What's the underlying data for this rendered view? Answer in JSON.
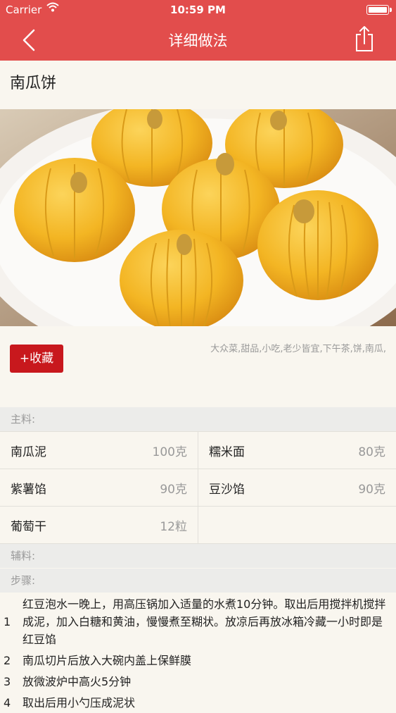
{
  "status_bar": {
    "carrier": "Carrier",
    "time": "10:59 PM"
  },
  "nav": {
    "title": "详细做法",
    "back_icon": "chevron-left-icon",
    "share_icon": "share-icon"
  },
  "recipe": {
    "name": "南瓜饼",
    "favorite_label": "+收藏",
    "tags": "大众菜,甜品,小吃,老少皆宜,下午茶,饼,南瓜,"
  },
  "sections": {
    "main_ingredients": "主料:",
    "auxiliary": "辅料:",
    "steps": "步骤:"
  },
  "ingredients": [
    {
      "name": "南瓜泥",
      "qty": "100克"
    },
    {
      "name": "糯米面",
      "qty": "80克"
    },
    {
      "name": "紫薯馅",
      "qty": "90克"
    },
    {
      "name": "豆沙馅",
      "qty": "90克"
    },
    {
      "name": "葡萄干",
      "qty": "12粒"
    }
  ],
  "steps": [
    {
      "no": "1",
      "text": "红豆泡水一晚上，用高压锅加入适量的水煮10分钟。取出后用搅拌机搅拌成泥，加入白糖和黄油，慢慢煮至糊状。放凉后再放冰箱冷藏一小时即是红豆馅"
    },
    {
      "no": "2",
      "text": "南瓜切片后放入大碗内盖上保鲜膜"
    },
    {
      "no": "3",
      "text": "放微波炉中高火5分钟"
    },
    {
      "no": "4",
      "text": "取出后用小勺压成泥状"
    }
  ],
  "colors": {
    "theme_red": "#e24d4c",
    "button_red": "#c8181d",
    "background": "#f9f6ef"
  }
}
